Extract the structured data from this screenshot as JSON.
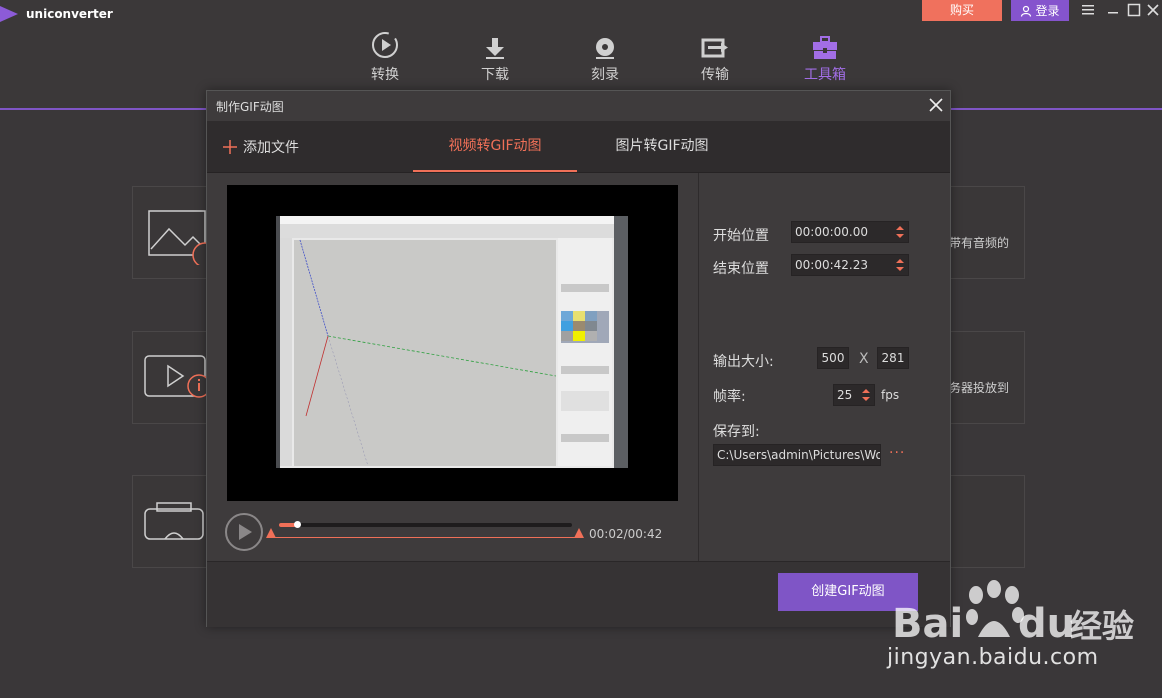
{
  "app": {
    "name": "uniconverter"
  },
  "header": {
    "nav": [
      {
        "label": "转换",
        "icon": "convert-icon",
        "active": false
      },
      {
        "label": "下载",
        "icon": "download-icon",
        "active": false
      },
      {
        "label": "刻录",
        "icon": "burn-disc-icon",
        "active": false
      },
      {
        "label": "传输",
        "icon": "transfer-icon",
        "active": false
      },
      {
        "label": "工具箱",
        "icon": "toolbox-icon",
        "active": true
      }
    ],
    "buy_label": "购买",
    "login_label": "登录"
  },
  "background": {
    "card1_text": "带有音频的",
    "card2_text": "务器投放到"
  },
  "dialog": {
    "title": "制作GIF动图",
    "add_file_label": "添加文件",
    "tabs": [
      {
        "label": "视频转GIF动图",
        "active": true
      },
      {
        "label": "图片转GIF动图",
        "active": false
      }
    ],
    "player": {
      "time": "00:02/00:42",
      "progress": 0.06
    },
    "settings": {
      "start_label": "开始位置",
      "start_value": "00:00:00.00",
      "end_label": "结束位置",
      "end_value": "00:00:42.23",
      "size_label": "输出大小:",
      "width": "500",
      "x_label": "X",
      "height": "281",
      "fps_label": "帧率:",
      "fps_value": "25",
      "fps_unit": "fps",
      "save_label": "保存到:",
      "save_path": "C:\\Users\\admin\\Pictures\\Wond",
      "more_label": "···"
    },
    "create_label": "创建GIF动图"
  },
  "watermark": {
    "text": "jingyan.baidu.com"
  },
  "colors": {
    "accent_purple": "#7f55c6",
    "accent_orange": "#f07058",
    "buy_red": "#f0715d"
  }
}
